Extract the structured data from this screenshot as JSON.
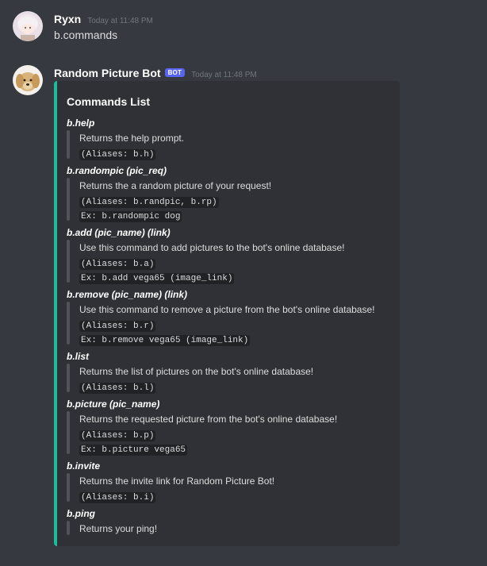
{
  "message1": {
    "username": "Ryxn",
    "timestamp": "Today at 11:48 PM",
    "text": "b.commands"
  },
  "message2": {
    "username": "Random Picture Bot",
    "bot_tag": "BOT",
    "timestamp": "Today at 11:48 PM",
    "embed": {
      "accent_color": "#1abc9c",
      "title": "Commands List",
      "commands": [
        {
          "name": "b.help",
          "description": "Returns the help prompt.",
          "aliases": "(Aliases: b.h)",
          "example": ""
        },
        {
          "name": "b.randompic (pic_req)",
          "description": "Returns the a random picture of your request!",
          "aliases": "(Aliases: b.randpic, b.rp)",
          "example": "Ex: b.randompic dog"
        },
        {
          "name": "b.add (pic_name) (link)",
          "description": "Use this command to add pictures to the bot's online database!",
          "aliases": "(Aliases: b.a)",
          "example": "Ex: b.add vega65 (image_link)"
        },
        {
          "name": "b.remove (pic_name) (link)",
          "description": "Use this command to remove a picture from the bot's online database!",
          "aliases": "(Aliases:  b.r)",
          "example": "Ex: b.remove vega65 (image_link)"
        },
        {
          "name": "b.list",
          "description": "Returns the list of pictures on the bot's online database!",
          "aliases": "(Aliases: b.l)",
          "example": ""
        },
        {
          "name": "b.picture (pic_name)",
          "description": "Returns the requested picture from the bot's online database!",
          "aliases": "(Aliases: b.p)",
          "example": "Ex: b.picture vega65"
        },
        {
          "name": "b.invite",
          "description": "Returns the invite link for Random Picture Bot!",
          "aliases": "(Aliases: b.i)",
          "example": ""
        },
        {
          "name": "b.ping",
          "description": "Returns your ping!",
          "aliases": "",
          "example": ""
        }
      ]
    }
  },
  "colors": {
    "background": "#36393f",
    "embed_background": "#2f3136",
    "bot_tag": "#5865f2",
    "username": "#ffffff",
    "timestamp": "#72767d"
  }
}
